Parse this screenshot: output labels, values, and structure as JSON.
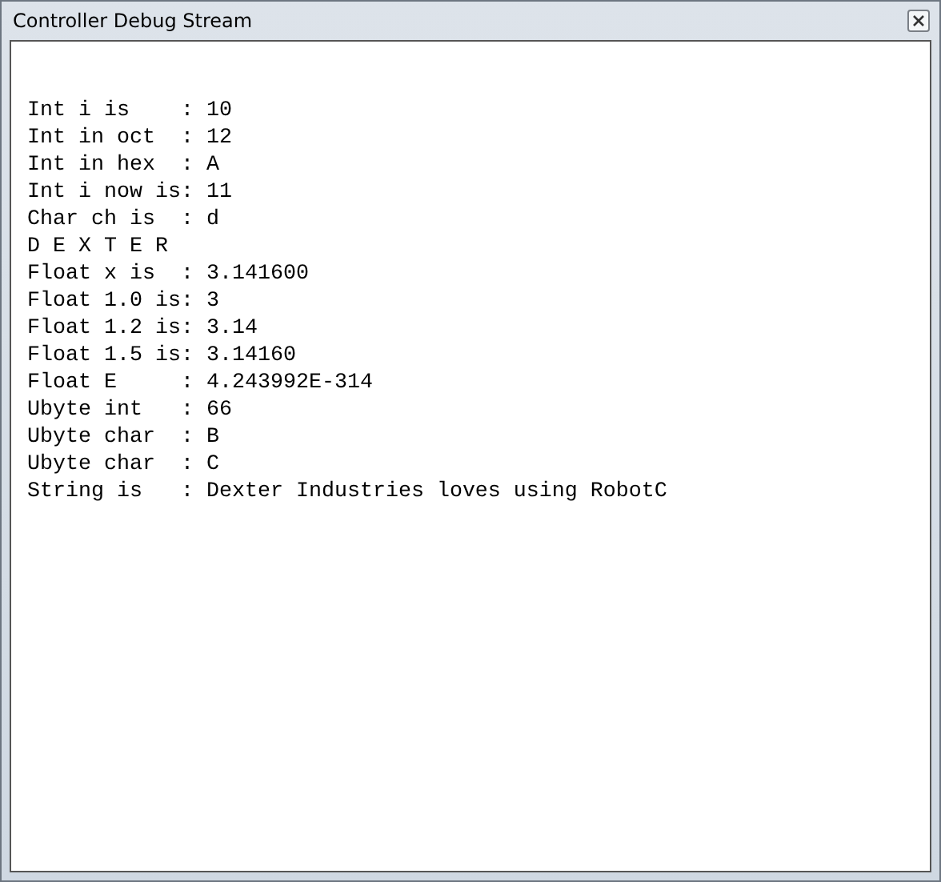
{
  "window": {
    "title": "Controller Debug Stream"
  },
  "lines": [
    "Int i is    : 10",
    "Int in oct  : 12",
    "Int in hex  : A",
    "Int i now is: 11",
    "Char ch is  : d",
    "D E X T E R",
    "Float x is  : 3.141600",
    "Float 1.0 is: 3",
    "Float 1.2 is: 3.14",
    "Float 1.5 is: 3.14160",
    "Float E     : 4.243992E-314",
    "Ubyte int   : 66",
    "Ubyte char  : B",
    "Ubyte char  : C",
    "String is   : Dexter Industries loves using RobotC"
  ]
}
